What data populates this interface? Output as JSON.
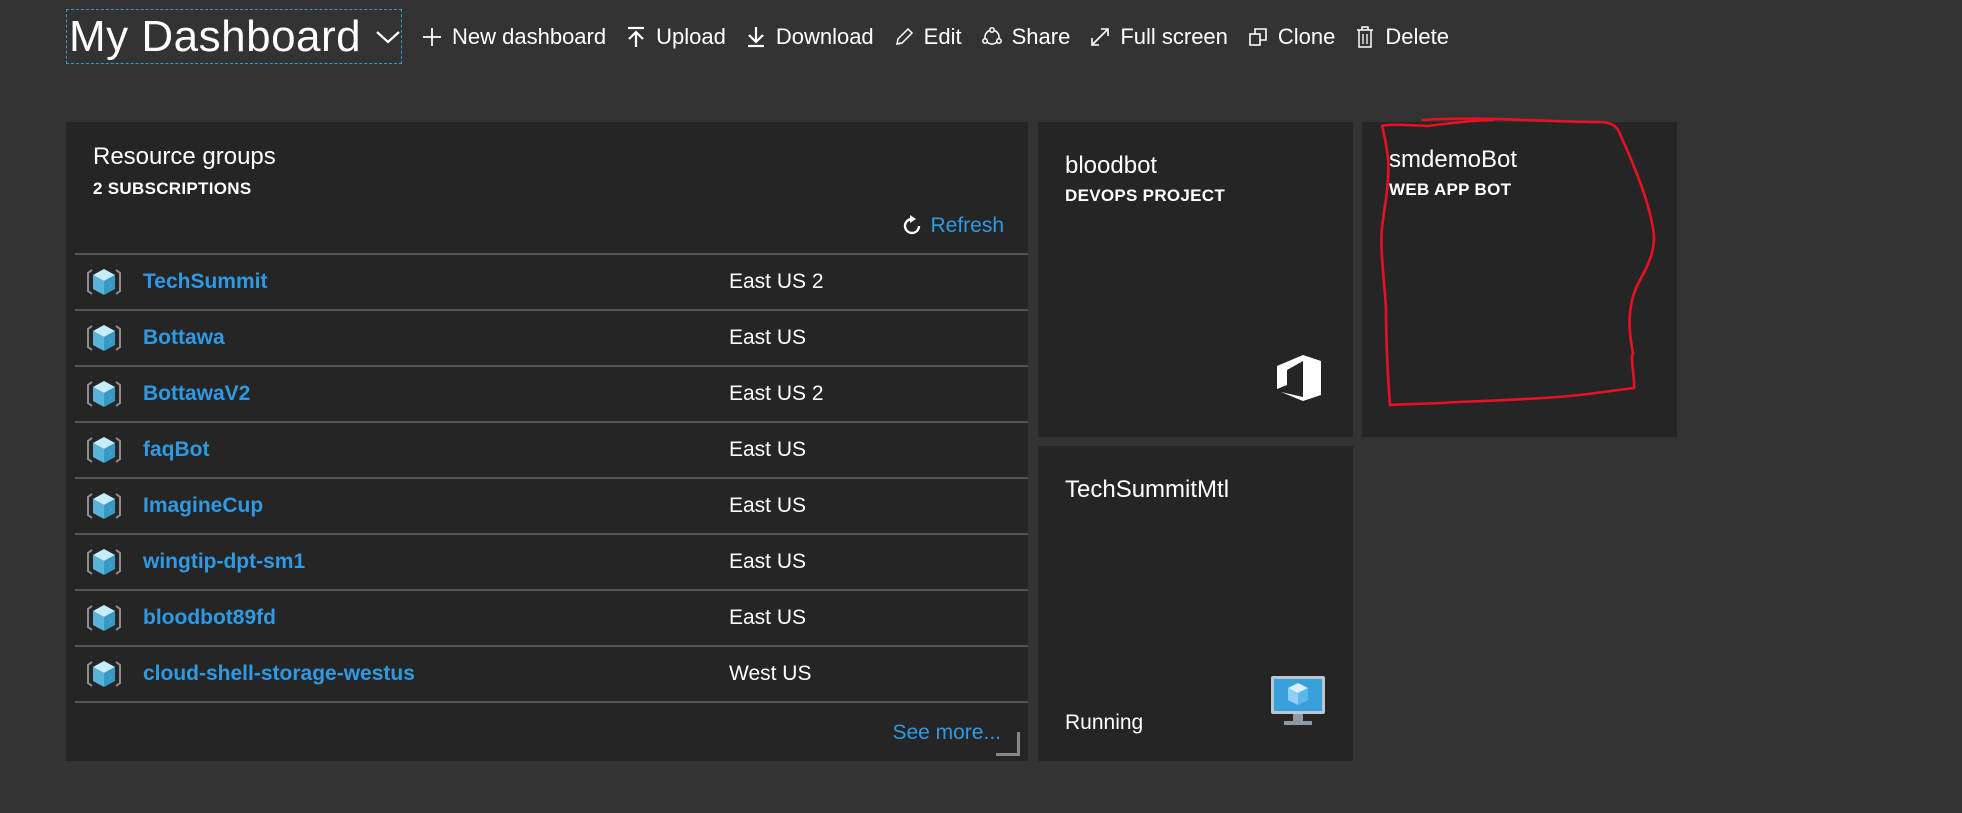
{
  "dashboard": {
    "title": "My Dashboard"
  },
  "toolbar": {
    "new_dashboard": "New dashboard",
    "upload": "Upload",
    "download": "Download",
    "edit": "Edit",
    "share": "Share",
    "full_screen": "Full screen",
    "clone": "Clone",
    "delete": "Delete"
  },
  "resource_groups": {
    "title": "Resource groups",
    "subtitle": "2 SUBSCRIPTIONS",
    "refresh": "Refresh",
    "see_more": "See more...",
    "rows": [
      {
        "name": "TechSummit",
        "location": "East US 2",
        "icon": "resource-group-icon"
      },
      {
        "name": "Bottawa",
        "location": "East US",
        "icon": "resource-group-icon"
      },
      {
        "name": "BottawaV2",
        "location": "East US 2",
        "icon": "resource-group-icon"
      },
      {
        "name": "faqBot",
        "location": "East US",
        "icon": "resource-group-icon"
      },
      {
        "name": "ImagineCup",
        "location": "East US",
        "icon": "resource-group-icon"
      },
      {
        "name": "wingtip-dpt-sm1",
        "location": "East US",
        "icon": "resource-group-icon"
      },
      {
        "name": "bloodbot89fd",
        "location": "East US",
        "icon": "resource-group-icon"
      },
      {
        "name": "cloud-shell-storage-westus",
        "location": "West US",
        "icon": "resource-group-icon"
      }
    ]
  },
  "tiles": {
    "bloodbot": {
      "title": "bloodbot",
      "subtitle": "DEVOPS PROJECT",
      "icon": "devops-project-icon"
    },
    "smdemobot": {
      "title": "smdemoBot",
      "subtitle": "WEB APP BOT"
    },
    "techsummit": {
      "title": "TechSummitMtl",
      "status": "Running",
      "icon": "virtual-machine-icon"
    }
  },
  "colors": {
    "background": "#333333",
    "tile": "#252525",
    "link": "#2f9ae3",
    "annotation": "#e81123",
    "focus_border": "#2f9ad6"
  }
}
